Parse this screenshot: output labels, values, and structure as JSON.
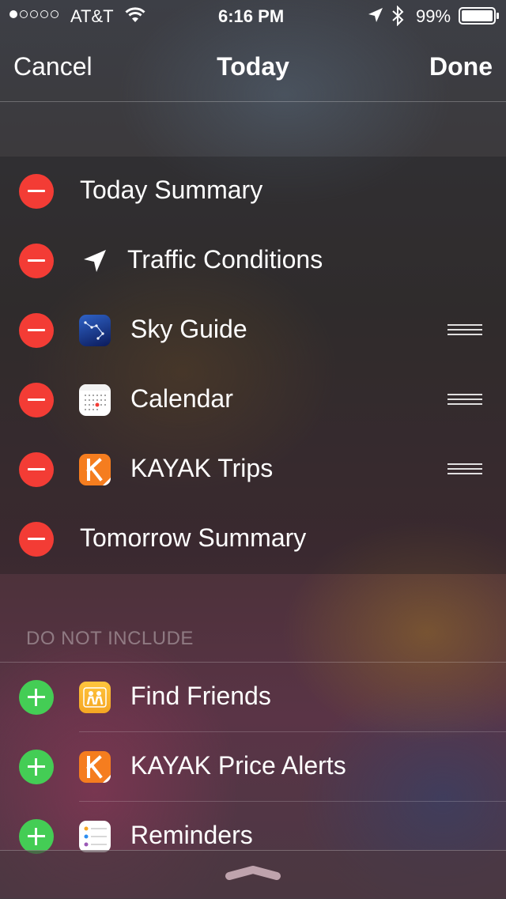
{
  "status_bar": {
    "carrier": "AT&T",
    "time": "6:16 PM",
    "battery": "99%",
    "signal_bars": 1,
    "icons": [
      "signal-dots-icon",
      "wifi-icon",
      "location-arrow-icon",
      "bluetooth-icon",
      "battery-icon"
    ]
  },
  "nav": {
    "cancel_label": "Cancel",
    "title": "Today",
    "done_label": "Done"
  },
  "included": {
    "items": [
      {
        "label": "Today Summary",
        "icon": null,
        "reorderable": false
      },
      {
        "label": "Traffic Conditions",
        "icon": "location-arrow-icon",
        "reorderable": false
      },
      {
        "label": "Sky Guide",
        "icon": "sky-guide-app-icon",
        "reorderable": true
      },
      {
        "label": "Calendar",
        "icon": "calendar-app-icon",
        "reorderable": true
      },
      {
        "label": "KAYAK Trips",
        "icon": "kayak-app-icon",
        "reorderable": true
      },
      {
        "label": "Tomorrow Summary",
        "icon": null,
        "reorderable": false
      }
    ]
  },
  "excluded": {
    "header": "DO NOT INCLUDE",
    "items": [
      {
        "label": "Find Friends",
        "icon": "find-friends-app-icon"
      },
      {
        "label": "KAYAK Price Alerts",
        "icon": "kayak-app-icon"
      },
      {
        "label": "Reminders",
        "icon": "reminders-app-icon"
      }
    ]
  },
  "colors": {
    "remove": "#f33c35",
    "add": "#44cd55",
    "kayak_orange": "#f57d1f"
  }
}
